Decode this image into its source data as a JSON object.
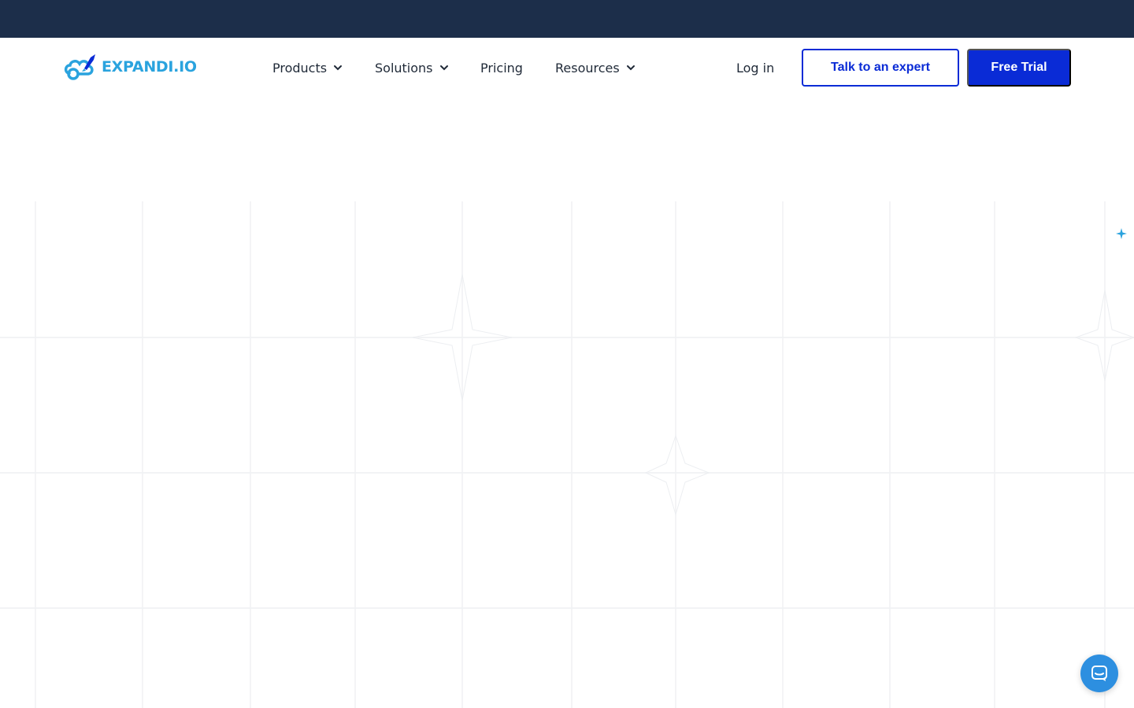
{
  "brand": {
    "logo_text": "EXPANDI.IO",
    "logo_icon": "rocket-cloud-icon",
    "color_primary": "#0a2bd6",
    "color_logo": "#2aa3de",
    "color_top_strip": "#1c2e4a"
  },
  "nav": {
    "items": [
      {
        "label": "Products",
        "has_dropdown": true
      },
      {
        "label": "Solutions",
        "has_dropdown": true
      },
      {
        "label": "Pricing",
        "has_dropdown": false
      },
      {
        "label": "Resources",
        "has_dropdown": true
      }
    ],
    "login_label": "Log in",
    "expert_button_label": "Talk to an expert",
    "trial_button_label": "Free Trial"
  },
  "hero": {
    "background": "faint-grid-pattern",
    "decoration_icon": "sparkle-icon"
  },
  "chat": {
    "icon": "chat-bubble-icon",
    "color": "#2d8fe0"
  }
}
